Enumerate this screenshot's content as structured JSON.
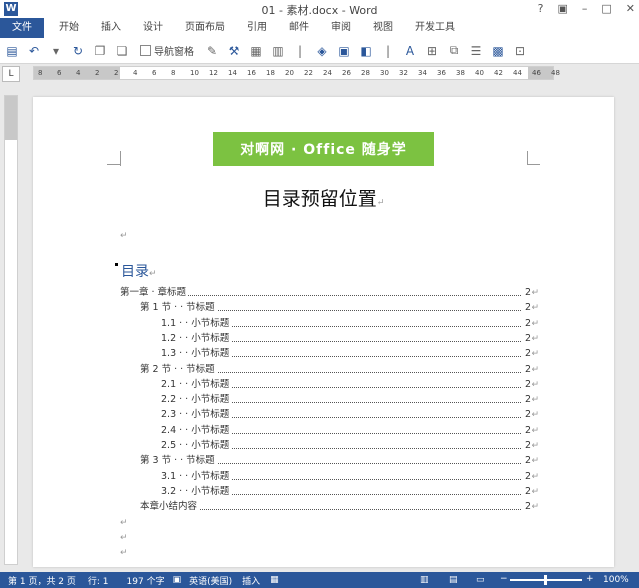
{
  "window": {
    "title": "01 - 素材.docx - Word",
    "app_icon": "W"
  },
  "tabs": [
    "文件",
    "开始",
    "插入",
    "设计",
    "页面布局",
    "引用",
    "邮件",
    "审阅",
    "视图",
    "开发工具"
  ],
  "toolbar": {
    "nav_pane_label": "导航窗格"
  },
  "ruler": {
    "corner": "L",
    "numbers": [
      "8",
      "6",
      "4",
      "2",
      "2",
      "4",
      "6",
      "8",
      "10",
      "12",
      "14",
      "16",
      "18",
      "20",
      "22",
      "24",
      "26",
      "28",
      "30",
      "32",
      "34",
      "36",
      "38",
      "40",
      "42",
      "44",
      "46",
      "48"
    ]
  },
  "document": {
    "banner_text": "对啊网 · Office 随身学",
    "title": "目录预留位置",
    "para_mark": "↵",
    "toc_heading": "目录",
    "toc": [
      {
        "text": "第一章 · 章标题",
        "page": "2",
        "level": 0
      },
      {
        "text": "第 1 节 · · 节标题",
        "page": "2",
        "level": 1
      },
      {
        "text": "1.1 · · 小节标题",
        "page": "2",
        "level": 2
      },
      {
        "text": "1.2 · · 小节标题",
        "page": "2",
        "level": 2
      },
      {
        "text": "1.3 · · 小节标题",
        "page": "2",
        "level": 2
      },
      {
        "text": "第 2 节 · · 节标题",
        "page": "2",
        "level": 1
      },
      {
        "text": "2.1 · · 小节标题",
        "page": "2",
        "level": 2
      },
      {
        "text": "2.2 · · 小节标题",
        "page": "2",
        "level": 2
      },
      {
        "text": "2.3 · · 小节标题",
        "page": "2",
        "level": 2
      },
      {
        "text": "2.4 · · 小节标题",
        "page": "2",
        "level": 2
      },
      {
        "text": "2.5 · · 小节标题",
        "page": "2",
        "level": 2
      },
      {
        "text": "第 3 节 · · 节标题",
        "page": "2",
        "level": 1
      },
      {
        "text": "3.1 · · 小节标题",
        "page": "2",
        "level": 2
      },
      {
        "text": "3.2 · · 小节标题",
        "page": "2",
        "level": 2
      },
      {
        "text": "本章小结内容",
        "page": "2",
        "level": 1
      }
    ]
  },
  "status": {
    "page": "第 1 页，共 2 页",
    "line": "行: 1",
    "words": "197 个字",
    "lang": "英语(美国)",
    "mode": "插入",
    "zoom": "100%"
  },
  "colors": {
    "accent": "#2b579a",
    "banner": "#7cc241",
    "toc_heading": "#2b579a"
  }
}
